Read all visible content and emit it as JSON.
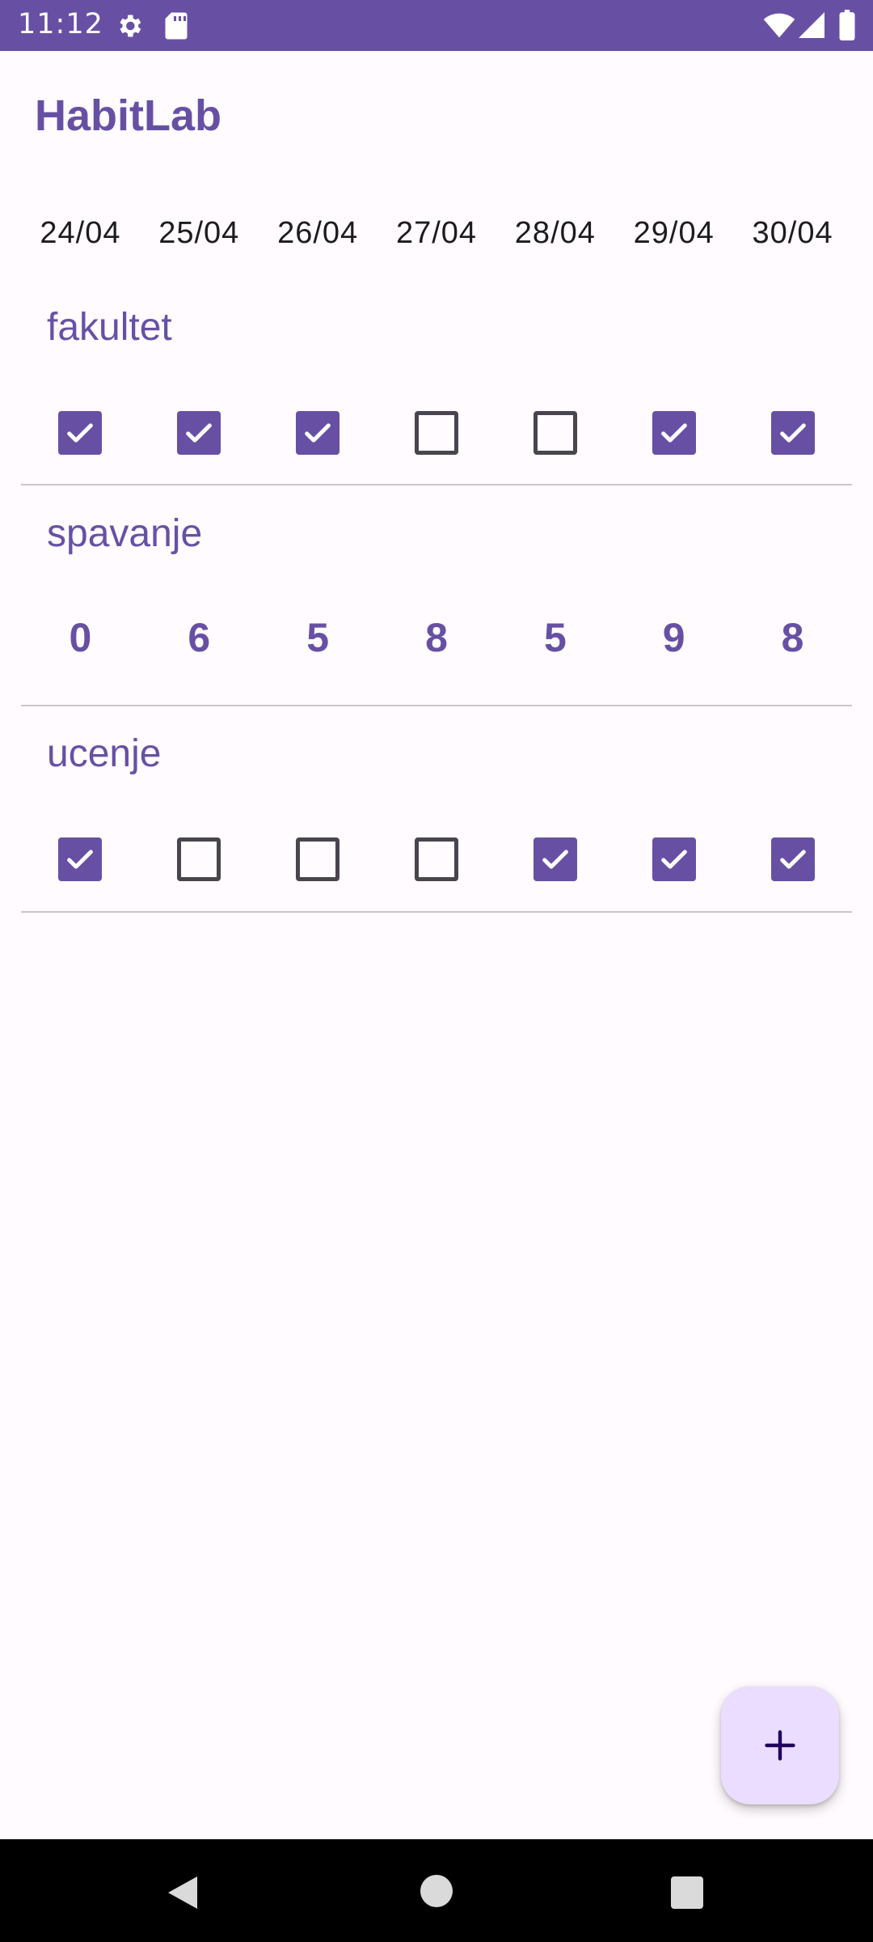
{
  "status_bar": {
    "time": "11:12",
    "icons": [
      "settings-icon",
      "sd-card-icon",
      "wifi-icon",
      "signal-icon",
      "battery-icon"
    ]
  },
  "app": {
    "title": "HabitLab"
  },
  "dates": [
    "24/04",
    "25/04",
    "26/04",
    "27/04",
    "28/04",
    "29/04",
    "30/04"
  ],
  "habits": [
    {
      "name": "fakultet",
      "type": "checkbox",
      "values": [
        true,
        true,
        true,
        false,
        false,
        true,
        true
      ]
    },
    {
      "name": "spavanje",
      "type": "number",
      "values": [
        "0",
        "6",
        "5",
        "8",
        "5",
        "9",
        "8"
      ]
    },
    {
      "name": "ucenje",
      "type": "checkbox",
      "values": [
        true,
        false,
        false,
        false,
        true,
        true,
        true
      ]
    }
  ],
  "fab": {
    "icon": "plus-icon"
  },
  "nav": {
    "icons": [
      "back-icon",
      "home-icon",
      "recents-icon"
    ]
  },
  "colors": {
    "primary": "#6750A4",
    "background": "#FFFBFE",
    "fab_container": "#EADDFF",
    "divider": "#C9C5CC"
  }
}
